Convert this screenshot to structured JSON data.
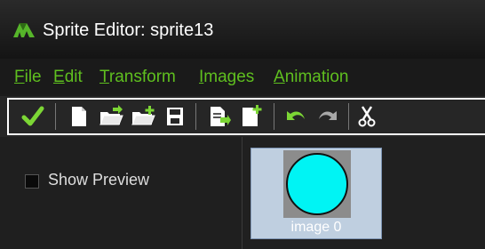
{
  "window": {
    "title": "Sprite Editor: sprite13",
    "app_icon": "gamemaker-logo-icon"
  },
  "menu": {
    "items": [
      {
        "label": "File",
        "mnemonic": "F",
        "rest": "ile"
      },
      {
        "label": "Edit",
        "mnemonic": "E",
        "rest": "dit"
      },
      {
        "label": "Transform",
        "mnemonic": "T",
        "rest": "ransform"
      },
      {
        "label": "Images",
        "mnemonic": "I",
        "rest": "mages"
      },
      {
        "label": "Animation",
        "mnemonic": "A",
        "rest": "nimation"
      }
    ]
  },
  "toolbar": {
    "buttons": [
      {
        "icon": "checkmark-icon"
      },
      {
        "icon": "new-file-icon"
      },
      {
        "icon": "open-folder-icon"
      },
      {
        "icon": "add-from-file-icon"
      },
      {
        "icon": "save-icon"
      },
      {
        "icon": "edit-image-icon"
      },
      {
        "icon": "new-image-icon"
      },
      {
        "icon": "undo-icon"
      },
      {
        "icon": "redo-icon"
      },
      {
        "icon": "cut-icon"
      }
    ]
  },
  "preview": {
    "checkbox_label": "Show Preview",
    "checked": false
  },
  "images": [
    {
      "label": "image 0",
      "fill_color": "#00f4f4"
    }
  ],
  "colors": {
    "menu_text": "#5fbf1f",
    "selection": "#bfcfe0",
    "background": "#1b1b1b"
  }
}
